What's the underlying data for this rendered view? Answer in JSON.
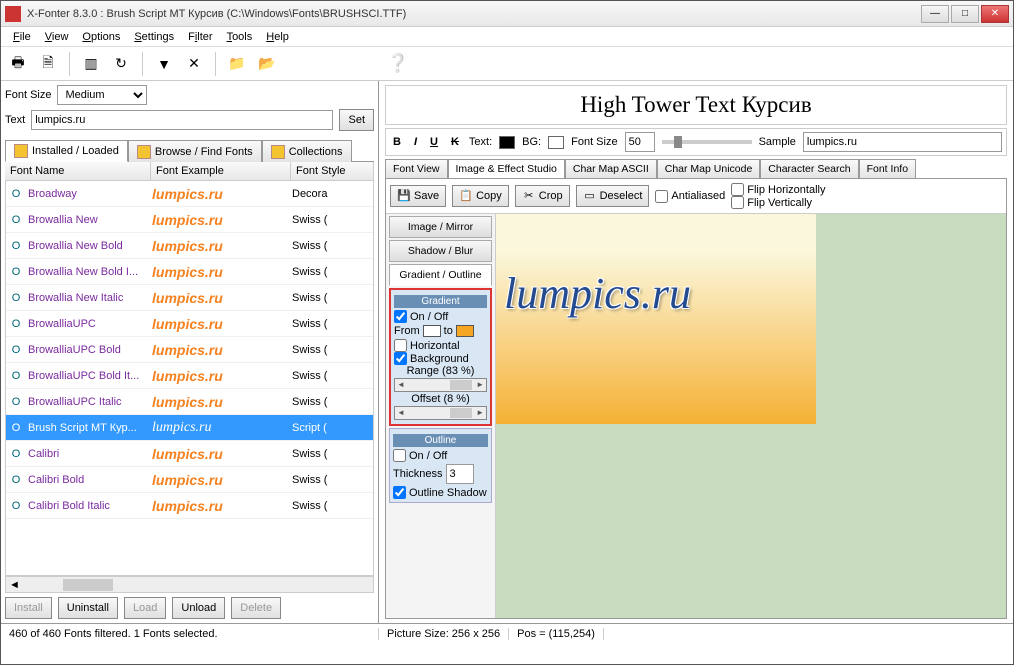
{
  "window": {
    "title": "X-Fonter 8.3.0  :  Brush Script MT Курсив (C:\\Windows\\Fonts\\BRUSHSCI.TTF)"
  },
  "menu": [
    "File",
    "View",
    "Options",
    "Settings",
    "Filter",
    "Tools",
    "Help"
  ],
  "left": {
    "fontsize_label": "Font Size",
    "fontsize_value": "Medium",
    "text_label": "Text",
    "text_value": "lumpics.ru",
    "set_btn": "Set",
    "tabs": [
      "Installed / Loaded",
      "Browse / Find Fonts",
      "Collections"
    ],
    "columns": [
      "Font Name",
      "Font Example",
      "Font Style"
    ],
    "rows": [
      {
        "name": "Broadway",
        "ex": "lumpics.ru",
        "style": "Decora"
      },
      {
        "name": "Browallia New",
        "ex": "lumpics.ru",
        "style": "Swiss ("
      },
      {
        "name": "Browallia New Bold",
        "ex": "lumpics.ru",
        "style": "Swiss ("
      },
      {
        "name": "Browallia New Bold I...",
        "ex": "lumpics.ru",
        "style": "Swiss ("
      },
      {
        "name": "Browallia New Italic",
        "ex": "lumpics.ru",
        "style": "Swiss ("
      },
      {
        "name": "BrowalliaUPC",
        "ex": "lumpics.ru",
        "style": "Swiss ("
      },
      {
        "name": "BrowalliaUPC Bold",
        "ex": "lumpics.ru",
        "style": "Swiss ("
      },
      {
        "name": "BrowalliaUPC Bold It...",
        "ex": "lumpics.ru",
        "style": "Swiss ("
      },
      {
        "name": "BrowalliaUPC Italic",
        "ex": "lumpics.ru",
        "style": "Swiss ("
      },
      {
        "name": "Brush Script MT Кур...",
        "ex": "lumpics.ru",
        "style": "Script (",
        "sel": true
      },
      {
        "name": "Calibri",
        "ex": "lumpics.ru",
        "style": "Swiss ("
      },
      {
        "name": "Calibri Bold",
        "ex": "lumpics.ru",
        "style": "Swiss ("
      },
      {
        "name": "Calibri Bold Italic",
        "ex": "lumpics.ru",
        "style": "Swiss ("
      }
    ],
    "buttons": {
      "install": "Install",
      "uninstall": "Uninstall",
      "load": "Load",
      "unload": "Unload",
      "delete": "Delete"
    }
  },
  "right": {
    "title": "High Tower Text Курсив",
    "fmt": {
      "text": "Text:",
      "bg": "BG:",
      "fontsize": "Font Size",
      "fontsize_val": "50",
      "sample": "Sample",
      "sample_val": "lumpics.ru"
    },
    "tabs": [
      "Font View",
      "Image & Effect Studio",
      "Char Map ASCII",
      "Char Map Unicode",
      "Character Search",
      "Font Info"
    ],
    "tbuttons": {
      "save": "Save",
      "copy": "Copy",
      "crop": "Crop",
      "deselect": "Deselect"
    },
    "antialiased": "Antialiased",
    "fliph": "Flip Horizontally",
    "flipv": "Flip Vertically",
    "side_tabs": [
      "Image / Mirror",
      "Shadow / Blur",
      "Gradient / Outline"
    ],
    "gradient": {
      "title": "Gradient",
      "onoff": "On / Off",
      "from": "From",
      "to": "to",
      "horizontal": "Horizontal",
      "background": "Background",
      "range": "Range (83 %)",
      "offset": "Offset (8 %)"
    },
    "outline": {
      "title": "Outline",
      "onoff": "On / Off",
      "thickness": "Thickness",
      "thickness_val": "3",
      "shadow": "Outline Shadow"
    },
    "canvas_text": "lumpics.ru"
  },
  "status": {
    "left": "460 of 460 Fonts filtered.  1 Fonts selected.",
    "pic": "Picture Size: 256 x 256",
    "pos": "Pos = (115,254)"
  }
}
